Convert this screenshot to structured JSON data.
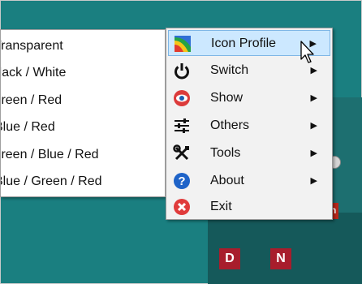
{
  "submenu": {
    "items": [
      {
        "label": "Transparent"
      },
      {
        "label": "Black / White"
      },
      {
        "label": "Green / Red"
      },
      {
        "label": "Blue / Red"
      },
      {
        "label": "Green / Blue / Red"
      },
      {
        "label": "Blue / Green / Red"
      }
    ]
  },
  "menu": {
    "items": [
      {
        "label": "Icon Profile",
        "icon": "rainbow-icon",
        "has_submenu": true,
        "highlighted": true
      },
      {
        "label": "Switch",
        "icon": "power-icon",
        "has_submenu": true
      },
      {
        "label": "Show",
        "icon": "eye-icon",
        "has_submenu": true
      },
      {
        "label": "Others",
        "icon": "sliders-icon",
        "has_submenu": true
      },
      {
        "label": "Tools",
        "icon": "tools-icon",
        "has_submenu": true
      },
      {
        "label": "About",
        "icon": "help-icon",
        "has_submenu": true
      },
      {
        "label": "Exit",
        "icon": "exit-icon",
        "has_submenu": false
      }
    ],
    "arrow_glyph": "▶"
  },
  "tray": {
    "tiles": [
      {
        "label": "D"
      },
      {
        "label": "N"
      }
    ],
    "edge_tile_label": "n"
  },
  "colors": {
    "desktop": "#1a7f80",
    "highlight": "#cce8ff",
    "tile": "#a81d2c"
  }
}
